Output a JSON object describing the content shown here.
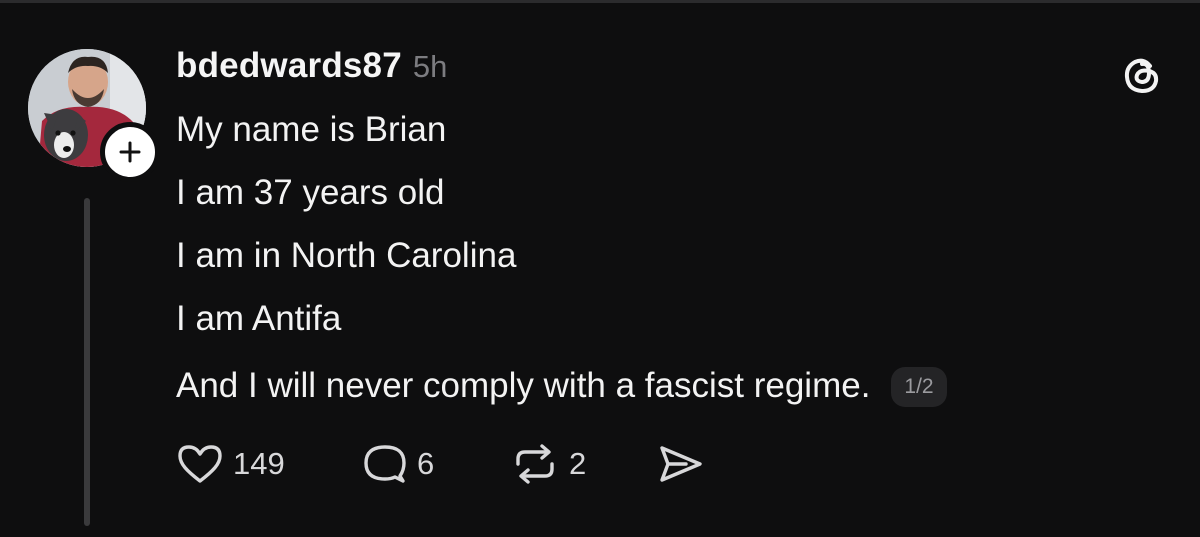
{
  "post": {
    "author": {
      "username": "bdedwards87",
      "avatar_icon": "profile-photo",
      "follow_icon": "plus-icon"
    },
    "timestamp": "5h",
    "app_logo_icon": "threads-logo-icon",
    "lines": [
      "My name is Brian",
      "I am 37 years old",
      "I am in North Carolina",
      "I am Antifa",
      "And I will never comply with a fascist regime."
    ],
    "page_indicator": "1/2",
    "actions": {
      "like": {
        "icon": "heart-icon",
        "count": "149"
      },
      "reply": {
        "icon": "comment-bubble-icon",
        "count": "6"
      },
      "repost": {
        "icon": "repost-icon",
        "count": "2"
      },
      "share": {
        "icon": "send-icon"
      }
    }
  },
  "colors": {
    "background": "#0e0e0f",
    "text_primary": "#f3f3f3",
    "text_secondary": "#7c7c80",
    "thread_line": "#3a3a3c",
    "badge_background": "#242426"
  }
}
